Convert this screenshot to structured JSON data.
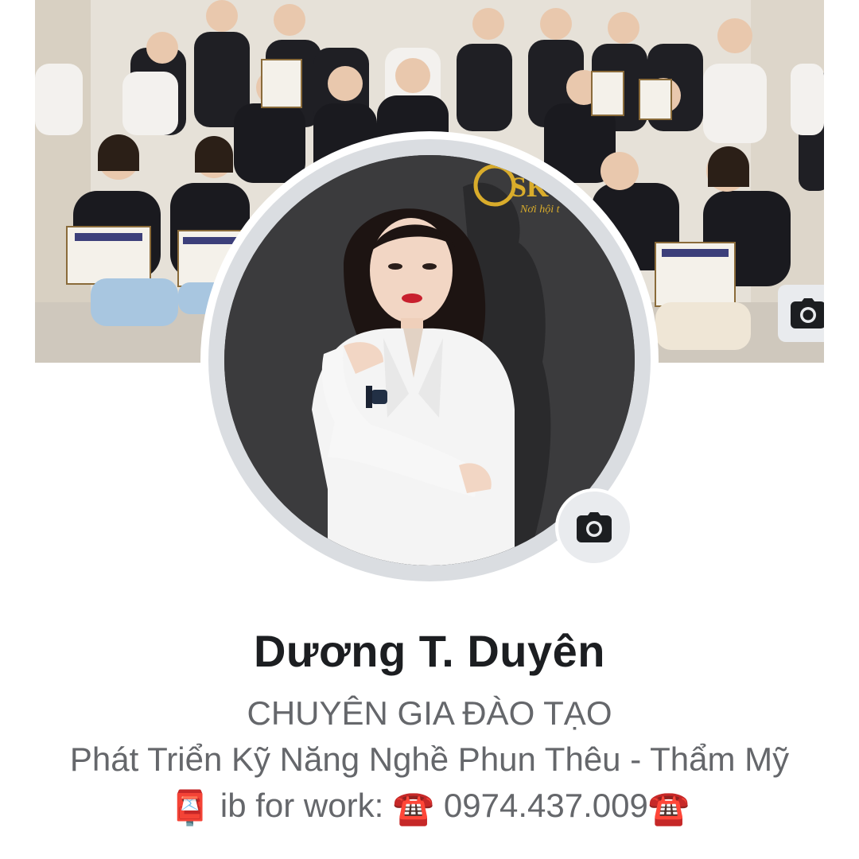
{
  "profile": {
    "name": "Dương T. Duyên",
    "bio_line1": "CHUYÊN GIA ĐÀO TẠO",
    "bio_line2": "Phát Triển Kỹ Năng Nghề Phun Thêu - Thẩm Mỹ",
    "bio_line3_text": "ib for work:",
    "bio_line3_phone": "0974.437.009",
    "postbox_emoji": "📮",
    "phone_emoji": "☎️"
  },
  "icons": {
    "cover_camera": "camera-icon",
    "avatar_camera": "camera-icon"
  },
  "colors": {
    "name_text": "#1c1e21",
    "bio_text": "#65676b",
    "camera_button_bg": "#e9ebee",
    "avatar_border": "#dadde1",
    "phone_red": "#d7263d"
  }
}
